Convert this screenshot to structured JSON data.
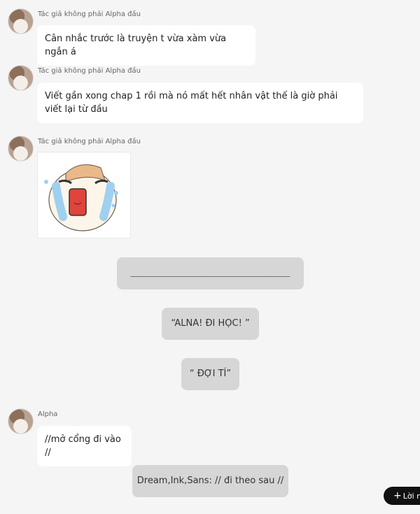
{
  "messages": [
    {
      "author": "Tác giả không phải Alpha đầu",
      "text": "Cân nhắc trước là truyện t vừa xàm vừa ngắn á"
    },
    {
      "author": "Tác giả không phải Alpha đầu",
      "text": "Viết gần xong chap 1 rồi mà nó mất hết nhân vật thế là giờ phải viết lại từ đầu"
    },
    {
      "author": "Tác giả không phải Alpha đầu",
      "sticker": "crying-face-sticker"
    },
    {
      "author": "Alpha",
      "text": "//mở cổng đi vào //"
    }
  ],
  "narration": [
    "______________________________________",
    "“ALNA! ĐI HỌC! ”",
    "“ ĐỢI TÍ”",
    "Dream,Ink,Sans: // đi theo sau //"
  ],
  "fab": {
    "label": "Lời nh"
  }
}
